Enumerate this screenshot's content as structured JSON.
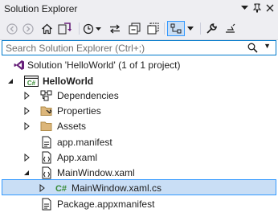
{
  "window": {
    "title": "Solution Explorer"
  },
  "search": {
    "placeholder": "Search Solution Explorer (Ctrl+;)"
  },
  "tree": {
    "solution": "Solution 'HelloWorld' (1 of 1 project)",
    "project": "HelloWorld",
    "project_badge": "C#",
    "items": [
      "Dependencies",
      "Properties",
      "Assets",
      "app.manifest",
      "App.xaml",
      "MainWindow.xaml",
      "MainWindow.xaml.cs",
      "Package.appxmanifest"
    ],
    "cs_badge": "C#"
  },
  "colors": {
    "accent": "#007acc",
    "selection_bg": "#c9def5",
    "selection_border": "#3399ff",
    "chrome_bg": "#eeeef2"
  }
}
